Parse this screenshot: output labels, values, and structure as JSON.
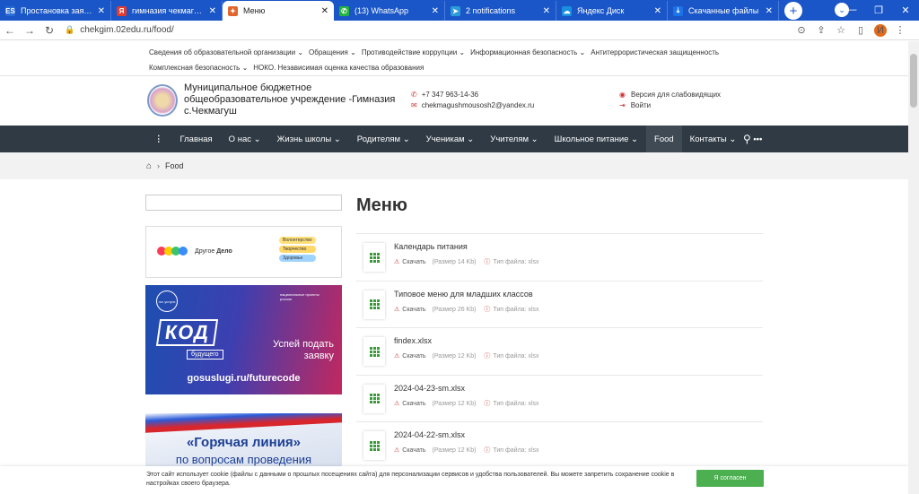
{
  "browser": {
    "tabs": [
      {
        "title": "Простановка заявок/с",
        "fav": "ES",
        "favColor": "#2a6bd4",
        "active": false
      },
      {
        "title": "гимназия чекмагуш о",
        "fav": "Я",
        "favColor": "#e23b2e",
        "active": false
      },
      {
        "title": "Меню",
        "fav": "✦",
        "favColor": "#e0662c",
        "active": true
      },
      {
        "title": "(13) WhatsApp",
        "fav": "✆",
        "favColor": "#25b33c",
        "active": false
      },
      {
        "title": "2 notifications",
        "fav": "➤",
        "favColor": "#2d9bd8",
        "active": false
      },
      {
        "title": "Яндекс Диск",
        "fav": "☁",
        "favColor": "#1a8fe0",
        "active": false
      },
      {
        "title": "Скачанные файлы",
        "fav": "⤓",
        "favColor": "#1a73e8",
        "active": false
      }
    ],
    "url": "chekgim.02edu.ru/food/",
    "profile_initial": "И"
  },
  "site": {
    "top_menu": [
      "Сведения об образовательной организации ⌄",
      "Обращения ⌄",
      "Противодействие коррупции ⌄",
      "Информационная безопасность ⌄",
      "Антитеррористическая защищенность",
      "Комплексная безопасность ⌄",
      "НОКО. Независимая оценка качества образования"
    ],
    "org_name": "Муниципальное бюджетное общеобразовательное учреждение -Гимназия с.Чекмагуш",
    "phone": "+7 347 963-14-36",
    "email": "chekmagushmousosh2@yandex.ru",
    "low_vision": "Версия для слабовидящих",
    "login": "Войти",
    "nav": [
      {
        "label": "Главная",
        "active": false
      },
      {
        "label": "О нас ⌄",
        "active": false
      },
      {
        "label": "Жизнь школы ⌄",
        "active": false
      },
      {
        "label": "Родителям ⌄",
        "active": false
      },
      {
        "label": "Ученикам ⌄",
        "active": false
      },
      {
        "label": "Учителям ⌄",
        "active": false
      },
      {
        "label": "Школьное питание ⌄",
        "active": false
      },
      {
        "label": "Food",
        "active": true
      },
      {
        "label": "Контакты ⌄",
        "active": false
      }
    ],
    "breadcrumb": "Food"
  },
  "sidebar": {
    "banner1": {
      "text_prefix": "Другое ",
      "text_bold": "Дело",
      "pills": [
        "Волонтерство",
        "Творчество",
        "Здоровье"
      ]
    },
    "banner2": {
      "gos": "гос услуги",
      "nat": "национальные проекты россии",
      "kod": "КОД",
      "budushchego": "будущего",
      "apply": "Успей подать заявку",
      "url": "gosuslugi.ru/futurecode"
    },
    "banner3": {
      "title": "«Горячая линия»",
      "subtitle": "по вопросам проведения"
    }
  },
  "main": {
    "title": "Меню",
    "download_label": "Скачать",
    "filetype_label": "Тип файла:",
    "files": [
      {
        "name": "Календарь питания",
        "size": "(Размер 14 Kb)",
        "type": "xlsx"
      },
      {
        "name": "Типовое меню для младших классов",
        "size": "(Размер 26 Kb)",
        "type": "xlsx"
      },
      {
        "name": "findex.xlsx",
        "size": "(Размер 12 Kb)",
        "type": "xlsx"
      },
      {
        "name": "2024-04-23-sm.xlsx",
        "size": "(Размер 12 Kb)",
        "type": "xlsx"
      },
      {
        "name": "2024-04-22-sm.xlsx",
        "size": "(Размер 12 Kb)",
        "type": "xlsx"
      }
    ]
  },
  "cookie": {
    "text": "Этот сайт использует cookie (файлы с данными о прошлых посещениях сайта) для персонализации сервисов и удобства пользователей. Вы можете запретить сохранение cookie в настройках своего браузера.",
    "button": "Я согласен"
  }
}
